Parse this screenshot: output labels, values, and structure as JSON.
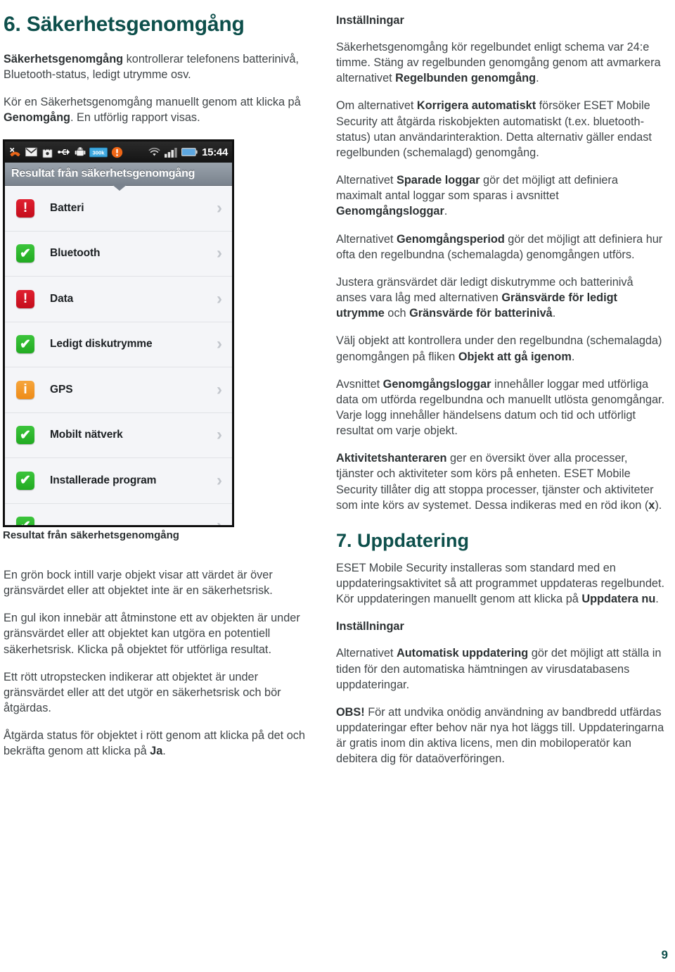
{
  "left": {
    "heading": "6. Säkerhetsgenomgång",
    "intro_1_bold": "Säkerhetsgenomgång",
    "intro_1_rest": " kontrollerar telefonens batterinivå, Bluetooth-status, ledigt utrymme osv.",
    "intro_2_pre": "Kör en Säkerhetsgenomgång manuellt genom att klicka på ",
    "intro_2_bold": "Genomgång",
    "intro_2_post": ". En utförlig rapport visas.",
    "caption": "Resultat från säkerhetsgenomgång",
    "p_green": "En grön bock intill varje objekt visar att värdet är över gränsvärdet eller att objektet inte är en säkerhetsrisk.",
    "p_yellow": "En gul ikon innebär att åtminstone ett av objekten är under gränsvärdet eller att objektet kan utgöra en potentiell säkerhetsrisk. Klicka på objektet för utförliga resultat.",
    "p_red": "Ett rött utropstecken indikerar att objektet är under gränsvärdet eller att det utgör en säkerhetsrisk och bör åtgärdas.",
    "p_fix_pre": "Åtgärda status för objektet i rött genom att klicka på det och bekräfta genom att klicka på ",
    "p_fix_bold": "Ja",
    "p_fix_post": "."
  },
  "phone": {
    "status_bar": {
      "icons": [
        "missed-call-icon",
        "gmail-icon",
        "market-bag-icon",
        "usb-icon",
        "android-robot-icon",
        "data-300k-badge-icon",
        "warning-circle-icon",
        "wifi-icon",
        "signal-bars-icon",
        "battery-icon"
      ],
      "data_badge_label": "300k",
      "clock": "15:44"
    },
    "title": "Resultat från säkerhetsgenomgång",
    "rows": [
      {
        "label": "Batteri",
        "status": "red",
        "glyph": "!",
        "color": "#d01423"
      },
      {
        "label": "Bluetooth",
        "status": "green",
        "glyph": "✔",
        "color": "#2bb52b"
      },
      {
        "label": "Data",
        "status": "red",
        "glyph": "!",
        "color": "#d01423"
      },
      {
        "label": "Ledigt diskutrymme",
        "status": "green",
        "glyph": "✔",
        "color": "#2bb52b"
      },
      {
        "label": "GPS",
        "status": "orange",
        "glyph": "i",
        "color": "#f09424"
      },
      {
        "label": "Mobilt nätverk",
        "status": "green",
        "glyph": "✔",
        "color": "#2bb52b"
      },
      {
        "label": "Installerade program",
        "status": "green",
        "glyph": "✔",
        "color": "#2bb52b"
      },
      {
        "label": "",
        "status": "green",
        "glyph": "✔",
        "color": "#2bb52b"
      }
    ],
    "chevron": "›"
  },
  "right": {
    "settings_heading_1": "Inställningar",
    "p1_a": "Säkerhetsgenomgång kör regelbundet enligt schema var 24:e timme. Stäng av regelbunden genomgång genom att avmarkera alternativet ",
    "p1_b": "Regelbunden genomgång",
    "p1_c": ".",
    "p2_a": "Om alternativet ",
    "p2_b": "Korrigera automatiskt",
    "p2_c": " försöker ESET Mobile Security att åtgärda riskobjekten automatiskt (t.ex. bluetooth-status) utan användarinteraktion. Detta alternativ gäller endast regelbunden (schemalagd) genomgång.",
    "p3_a": "Alternativet ",
    "p3_b": "Sparade loggar",
    "p3_c": " gör det möjligt att definiera maximalt antal loggar som sparas i avsnittet ",
    "p3_d": "Genomgångsloggar",
    "p3_e": ".",
    "p4_a": "Alternativet ",
    "p4_b": "Genomgångsperiod",
    "p4_c": " gör det möjligt att definiera hur ofta den regelbundna (schemalagda) genomgången utförs.",
    "p5_a": "Justera gränsvärdet där ledigt diskutrymme och batterinivå anses vara låg med alternativen ",
    "p5_b": "Gränsvärde för ledigt utrymme",
    "p5_c": " och ",
    "p5_d": "Gränsvärde för batterinivå",
    "p5_e": ".",
    "p6_a": "Välj objekt att kontrollera under den regelbundna (schemalagda) genomgången på fliken ",
    "p6_b": "Objekt att gå igenom",
    "p6_c": ".",
    "p7_a": "Avsnittet ",
    "p7_b": "Genomgångsloggar",
    "p7_c": " innehåller loggar med utförliga data om utförda regelbundna och manuellt utlösta genomgångar. Varje logg innehåller händelsens datum och tid och utförligt resultat om varje objekt.",
    "p8_a": "Aktivitetshanteraren",
    "p8_b": " ger en översikt över alla processer, tjänster och aktiviteter som körs på enheten. ESET Mobile Security tillåter dig att stoppa processer, tjänster och aktiviteter som inte körs av systemet. Dessa indikeras med en röd ikon (",
    "p8_c": "x",
    "p8_d": ").",
    "heading_7": "7. Uppdatering",
    "p9_a": "ESET Mobile Security installeras som standard med en uppdateringsaktivitet så att programmet uppdateras regelbundet. Kör uppdateringen manuellt genom att klicka på ",
    "p9_b": "Uppdatera nu",
    "p9_c": ".",
    "settings_heading_2": "Inställningar",
    "p10_a": "Alternativet ",
    "p10_b": "Automatisk uppdatering",
    "p10_c": " gör det möjligt att ställa in tiden för den automatiska hämtningen av virusdatabasens uppdateringar.",
    "p11_a": "OBS!",
    "p11_b": " För att undvika onödig användning av bandbredd utfärdas uppdateringar efter behov när nya hot läggs till. Uppdateringarna är gratis inom din aktiva licens, men din mobiloperatör kan debitera dig för dataöverföringen."
  },
  "footer": {
    "page_number": "9"
  },
  "colors": {
    "heading_teal": "#0d4f4b",
    "body_gray": "#404548",
    "status_red": "#d01423",
    "status_green": "#2bb52b",
    "status_orange": "#f09424"
  }
}
